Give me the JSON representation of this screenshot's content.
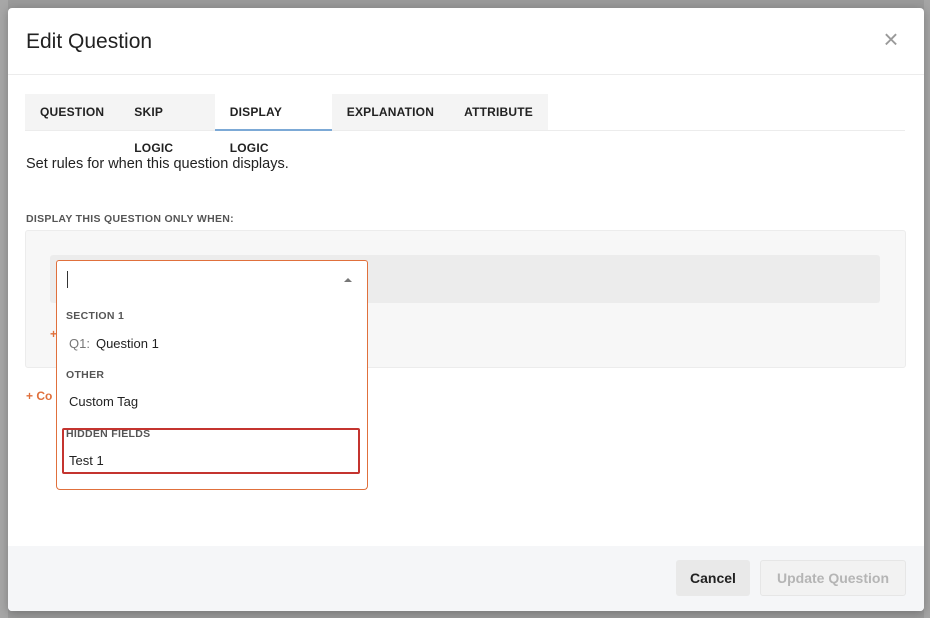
{
  "modal": {
    "title": "Edit Question",
    "close_icon": "close-icon"
  },
  "tabs": [
    {
      "label": "QUESTION",
      "active": false
    },
    {
      "label": "SKIP LOGIC",
      "active": false
    },
    {
      "label": "DISPLAY LOGIC",
      "active": true
    },
    {
      "label": "EXPLANATION",
      "active": false
    },
    {
      "label": "ATTRIBUTE",
      "active": false
    }
  ],
  "display_logic": {
    "intro": "Set rules for when this question displays.",
    "condition_header": "DISPLAY THIS QUESTION ONLY WHEN:",
    "add_condition_partial": "+",
    "add_group_partial": "+ Co",
    "select_value": ""
  },
  "dropdown": {
    "groups": [
      {
        "header": "SECTION 1",
        "options": [
          {
            "prefix": "Q1:",
            "label": "Question 1"
          }
        ]
      },
      {
        "header": "OTHER",
        "options": [
          {
            "prefix": "",
            "label": "Custom Tag"
          }
        ]
      },
      {
        "header": "HIDDEN FIELDS",
        "options": [
          {
            "prefix": "",
            "label": "Test 1"
          }
        ]
      }
    ],
    "highlight_color": "#c4342f"
  },
  "footer": {
    "cancel_label": "Cancel",
    "update_label": "Update Question"
  },
  "colors": {
    "accent_orange": "#e0703c",
    "tab_underline": "#7ca9d6"
  }
}
